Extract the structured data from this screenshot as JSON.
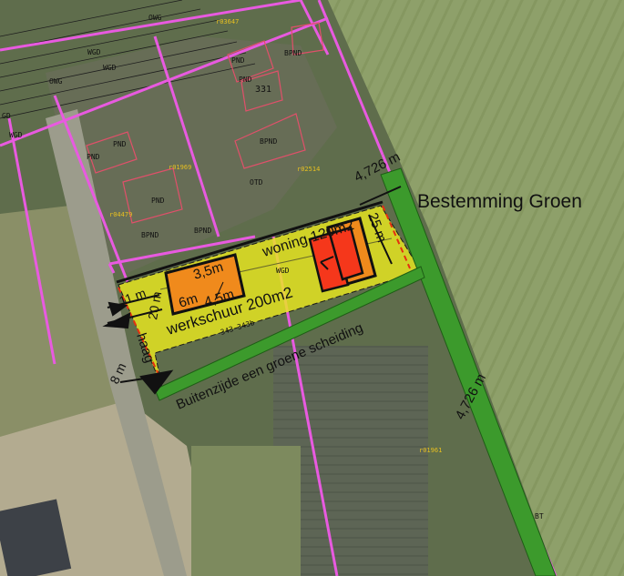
{
  "map": {
    "heading": "Bestemming Groen",
    "dims": {
      "top_width": "4,726 m",
      "side_width": "4,726 m",
      "depth": "25 m",
      "left_a": "11 m",
      "left_b": "20 m",
      "left_c": "8 m"
    },
    "buildings": {
      "woning": "woning 120m2",
      "werkschuur": "werkschuur 200m2",
      "box_w": "3,5m",
      "box_h": "6m",
      "box_d": "4,5m"
    },
    "notes": {
      "haag": "haag",
      "green_border": "Buitenzijde een groene scheiding"
    },
    "codes": {
      "wgd": "WGD",
      "owg": "OWG",
      "gd": "GD",
      "pnd": "PND",
      "bpnd": "BPND",
      "otd": "OTD",
      "bt": "BT",
      "n331": "331",
      "parcel_small": "343-343b",
      "parcel_a": "r03647",
      "parcel_b": "r01969",
      "parcel_c": "r02514",
      "parcel_d": "r04479",
      "parcel_e": "r01961"
    },
    "colors": {
      "plot_yellow": "#e9e820",
      "green_strip": "#3c9a2c",
      "boundary_pink": "#e85ae0",
      "house_red": "#f5371b",
      "barn_orange": "#f08a1c"
    }
  }
}
